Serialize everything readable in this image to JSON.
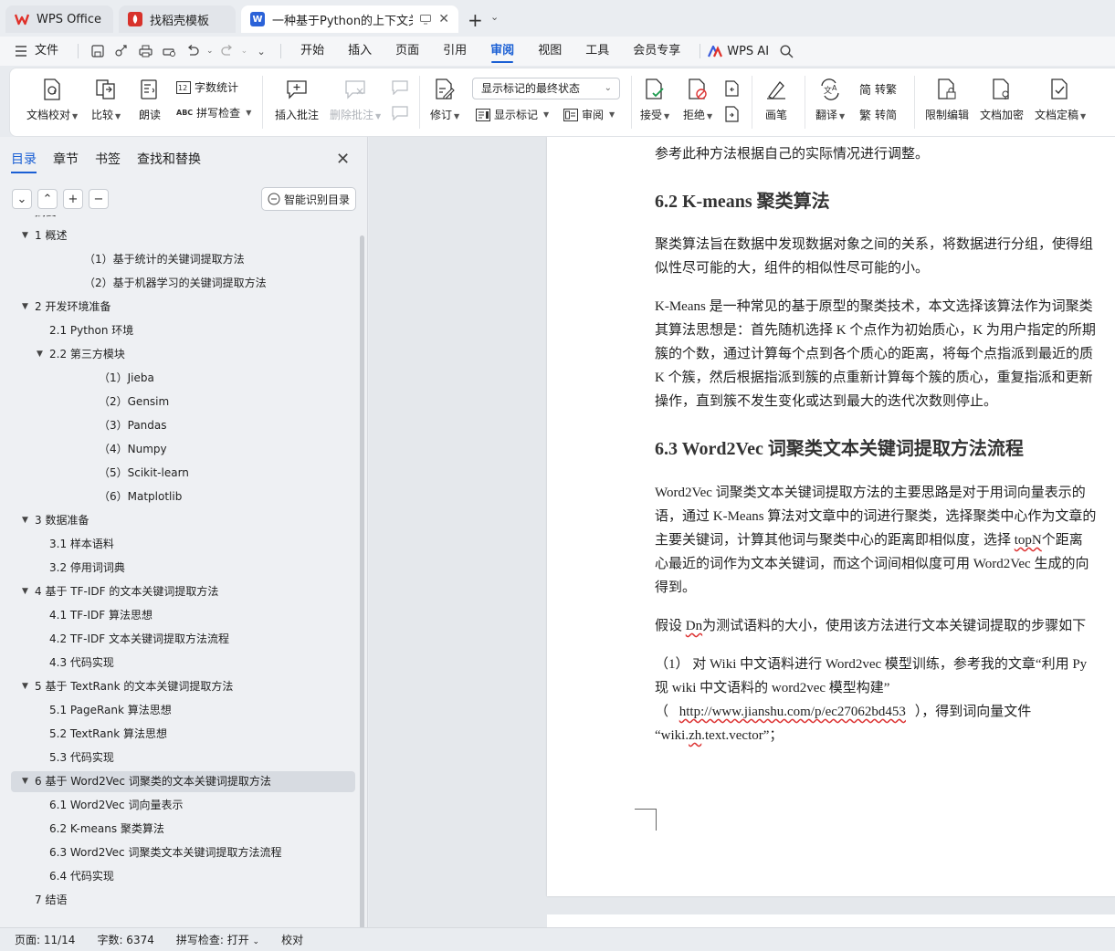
{
  "tabs": [
    {
      "label": "WPS Office",
      "icon": "wps-logo-icon"
    },
    {
      "label": "找稻壳模板",
      "icon": "docer-icon"
    },
    {
      "label": "一种基于Python的上下文关键",
      "icon": "word-doc-icon",
      "active": true
    }
  ],
  "menu": {
    "file": "文件",
    "items": [
      "开始",
      "插入",
      "页面",
      "引用",
      "审阅",
      "视图",
      "工具",
      "会员专享"
    ],
    "active": "审阅",
    "ai": "WPS AI"
  },
  "ribbon": {
    "doc_proofread": "文档校对",
    "compare": "比较",
    "read_aloud": "朗读",
    "word_count": "字数统计",
    "spell_check": "拼写检查",
    "insert_comment": "插入批注",
    "delete_comment": "删除批注",
    "track_changes": "修订",
    "markup_state": "显示标记的最终状态",
    "show_markup": "显示标记",
    "review": "审阅",
    "accept": "接受",
    "reject": "拒绝",
    "pen": "画笔",
    "translate": "翻译",
    "to_traditional": "转繁",
    "to_simplified": "转简",
    "restrict_edit": "限制编辑",
    "doc_encrypt": "文档加密",
    "doc_finalize": "文档定稿"
  },
  "nav": {
    "tabs": [
      "目录",
      "章节",
      "书签",
      "查找和替换"
    ],
    "active_tab": "目录",
    "smart_toc": "智能识别目录",
    "toc": [
      {
        "label": "摘要",
        "level": 0
      },
      {
        "label": "1  概述",
        "level": 0,
        "expanded": true
      },
      {
        "label": "（1）基于统计的关键词提取方法",
        "level": 2
      },
      {
        "label": "（2）基于机器学习的关键词提取方法",
        "level": 2
      },
      {
        "label": "2  开发环境准备",
        "level": 0,
        "expanded": true
      },
      {
        "label": "2.1 Python 环境",
        "level": 1
      },
      {
        "label": "2.2  第三方模块",
        "level": 1,
        "expanded": true
      },
      {
        "label": "（1）Jieba",
        "level": 3
      },
      {
        "label": "（2）Gensim",
        "level": 3
      },
      {
        "label": "（3）Pandas",
        "level": 3
      },
      {
        "label": "（4）Numpy",
        "level": 3
      },
      {
        "label": "（5）Scikit-learn",
        "level": 3
      },
      {
        "label": "（6）Matplotlib",
        "level": 3
      },
      {
        "label": "3  数据准备",
        "level": 0,
        "expanded": true
      },
      {
        "label": "3.1  样本语料",
        "level": 1
      },
      {
        "label": "3.2  停用词词典",
        "level": 1
      },
      {
        "label": "4  基于 TF-IDF 的文本关键词提取方法",
        "level": 0,
        "expanded": true
      },
      {
        "label": "4.1 TF-IDF 算法思想",
        "level": 1
      },
      {
        "label": "4.2 TF-IDF 文本关键词提取方法流程",
        "level": 1
      },
      {
        "label": "4.3  代码实现",
        "level": 1
      },
      {
        "label": "5  基于 TextRank 的文本关键词提取方法",
        "level": 0,
        "expanded": true
      },
      {
        "label": "5.1 PageRank 算法思想",
        "level": 1
      },
      {
        "label": "5.2 TextRank 算法思想",
        "level": 1
      },
      {
        "label": "5.3  代码实现",
        "level": 1
      },
      {
        "label": "6  基于 Word2Vec 词聚类的文本关键词提取方法",
        "level": 0,
        "expanded": true,
        "selected": true
      },
      {
        "label": "6.1 Word2Vec 词向量表示",
        "level": 1
      },
      {
        "label": "6.2 K-means 聚类算法",
        "level": 1
      },
      {
        "label": "6.3 Word2Vec 词聚类文本关键词提取方法流程",
        "level": 1
      },
      {
        "label": "6.4  代码实现",
        "level": 1
      },
      {
        "label": "7  结语",
        "level": 0
      }
    ]
  },
  "document": {
    "lines": [
      "参考此种方法根据自己的实际情况进行调整。",
      "聚类算法旨在数据中发现数据对象之间的关系，将数据进行分组，使得组",
      "似性尽可能的大，组件的相似性尽可能的小。",
      "K-Means 是一种常见的基于原型的聚类技术，本文选择该算法作为词聚类",
      "其算法思想是：首先随机选择 K 个点作为初始质心，K 为用户指定的所期",
      "簇的个数，通过计算每个点到各个质心的距离，将每个点指派到最近的质",
      "K 个簇，然后根据指派到簇的点重新计算每个簇的质心，重复指派和更新",
      "操作，直到簇不发生变化或达到最大的迭代次数则停止。",
      "Word2Vec 词聚类文本关键词提取方法的主要思路是对于用词向量表示的",
      "语，通过 K-Means 算法对文章中的词进行聚类，选择聚类中心作为文章的",
      "主要关键词，计算其他词与聚类中心的距离即相似度，选择 ",
      "心最近的词作为文本关键词，而这个词间相似度可用 Word2Vec 生成的向",
      "得到。",
      "假设 ",
      "（1） 对 Wiki 中文语料进行 Word2vec 模型训练，参考我的文章“利用 Py",
      "现 wiki 中文语料的 word2vec 模型构建”",
      "（ ",
      " ），得到词向量文件",
      "“",
      "”；"
    ],
    "topn_word": "topN",
    "topn_rest": "个距离",
    "dn_word": "Dn",
    "dn_rest": "为测试语料的大小，使用该方法进行文本关键词提取的步骤如下",
    "link": "http://www.jianshu.com/p/ec27062bd453",
    "file_prefix": "wiki.",
    "file_squig": "zh",
    "file_suffix": ".text.vector",
    "heading_62": "6.2 K-means 聚类算法",
    "heading_63": "6.3 Word2Vec 词聚类文本关键词提取方法流程"
  },
  "status": {
    "page": "页面: 11/14",
    "words": "字数: 6374",
    "spell": "拼写检查: 打开",
    "proof": "校对"
  },
  "colors": {
    "accent": "#1a5fd4",
    "wps_red": "#e0312a",
    "docer_red": "#d8322b",
    "word_blue": "#2b62d8"
  }
}
